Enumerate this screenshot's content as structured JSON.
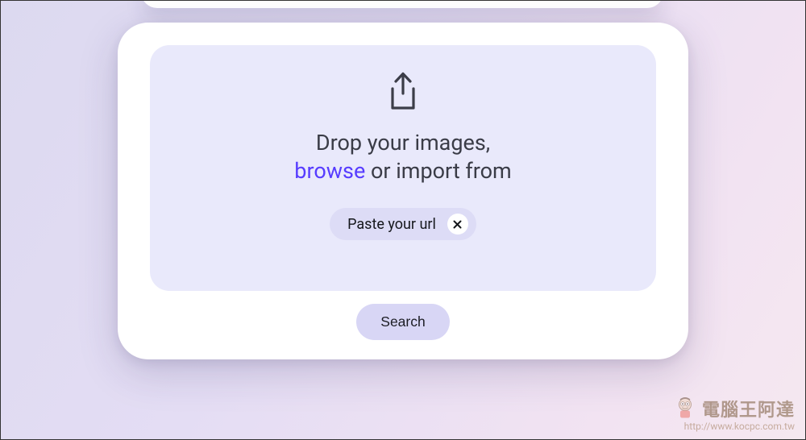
{
  "dropzone": {
    "line1": "Drop your images,",
    "browse": "browse",
    "line2_rest": " or import from",
    "url_pill": "Paste your url"
  },
  "search_button": "Search",
  "watermark": {
    "title": "電腦王阿達",
    "url": "http://www.kocpc.com.tw"
  }
}
